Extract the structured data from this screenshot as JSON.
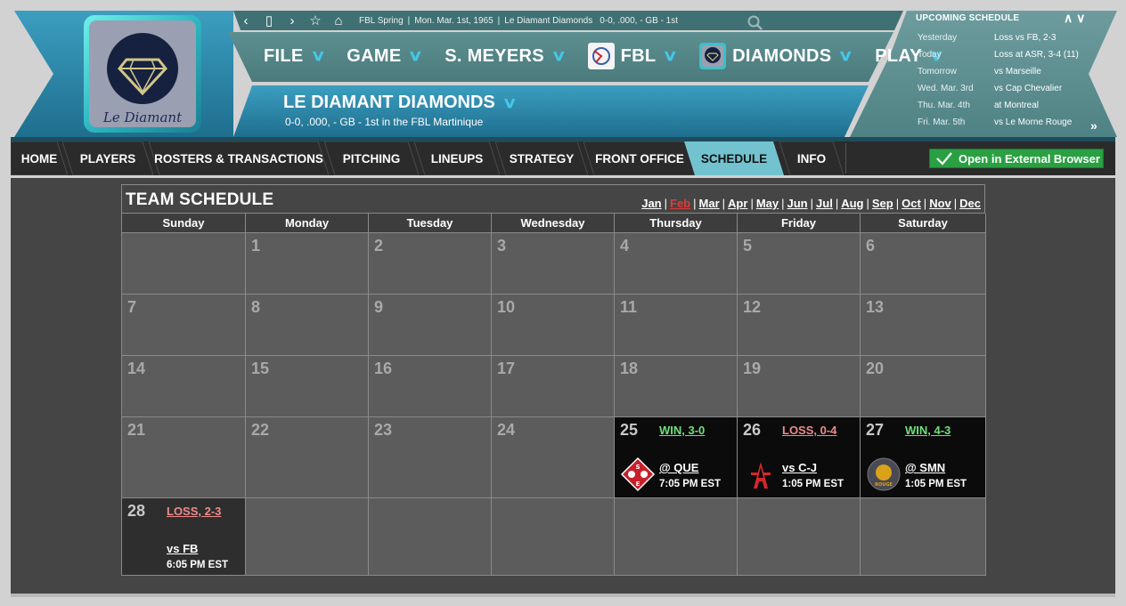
{
  "topbar": {
    "league_context": "FBL Spring",
    "date": "Mon. Mar. 1st, 1965",
    "team": "Le Diamant Diamonds",
    "record": "0-0, .000, - GB - 1st"
  },
  "logo": {
    "text": "Le Diamant"
  },
  "menu": [
    {
      "label": "FILE"
    },
    {
      "label": "GAME"
    },
    {
      "label": "S. MEYERS"
    },
    {
      "label": "FBL"
    },
    {
      "label": "DIAMONDS"
    },
    {
      "label": "PLAY"
    }
  ],
  "team_header": {
    "name": "LE DIAMANT DIAMONDS",
    "subtitle": "0-0, .000, - GB - 1st in the FBL Martinique"
  },
  "upcoming": {
    "title": "UPCOMING SCHEDULE",
    "rows": [
      {
        "day": "Yesterday",
        "result": "Loss vs FB, 2-3"
      },
      {
        "day": "Today",
        "result": "Loss at ASR, 3-4 (11)"
      },
      {
        "day": "Tomorrow",
        "result": "vs Marseille"
      },
      {
        "day": "Wed. Mar. 3rd",
        "result": "vs Cap Chevalier"
      },
      {
        "day": "Thu. Mar. 4th",
        "result": "at Montreal"
      },
      {
        "day": "Fri. Mar. 5th",
        "result": "vs Le Morne Rouge"
      }
    ]
  },
  "tabs": [
    {
      "label": "HOME"
    },
    {
      "label": "PLAYERS"
    },
    {
      "label": "ROSTERS & TRANSACTIONS"
    },
    {
      "label": "PITCHING"
    },
    {
      "label": "LINEUPS"
    },
    {
      "label": "STRATEGY"
    },
    {
      "label": "FRONT OFFICE"
    },
    {
      "label": "SCHEDULE"
    },
    {
      "label": "INFO"
    }
  ],
  "active_tab": "SCHEDULE",
  "external_button": "Open in External Browser",
  "calendar": {
    "title": "TEAM SCHEDULE",
    "months": [
      "Jan",
      "Feb",
      "Mar",
      "Apr",
      "May",
      "Jun",
      "Jul",
      "Aug",
      "Sep",
      "Oct",
      "Nov",
      "Dec"
    ],
    "current_month": "Feb",
    "weekdays": [
      "Sunday",
      "Monday",
      "Tuesday",
      "Wednesday",
      "Thursday",
      "Friday",
      "Saturday"
    ],
    "weeks": [
      [
        "",
        "1",
        "2",
        "3",
        "4",
        "5",
        "6"
      ],
      [
        "7",
        "8",
        "9",
        "10",
        "11",
        "12",
        "13"
      ],
      [
        "14",
        "15",
        "16",
        "17",
        "18",
        "19",
        "20"
      ],
      [
        "21",
        "22",
        "23",
        "24",
        "25",
        "26",
        "27"
      ],
      [
        "28",
        "",
        "",
        "",
        "",
        "",
        ""
      ]
    ],
    "games": {
      "25": {
        "result": "WIN, 3-0",
        "outcome": "win",
        "opponent": "@ QUE",
        "time": "7:05 PM EST",
        "logo": "que-logo"
      },
      "26": {
        "result": "LOSS, 0-4",
        "outcome": "loss",
        "opponent": "vs C-J",
        "time": "1:05 PM EST",
        "logo": "cj-logo"
      },
      "27": {
        "result": "WIN, 4-3",
        "outcome": "win",
        "opponent": "@ SMN",
        "time": "1:05 PM EST",
        "logo": "smn-logo"
      },
      "28": {
        "result": "LOSS, 2-3",
        "outcome": "loss",
        "opponent": "vs FB",
        "time": "6:05 PM EST",
        "logo": ""
      }
    }
  },
  "colors": {
    "header_blue": "#2a87a6",
    "header_teal": "#5a8a8c",
    "accent_cyan": "#43c7ea",
    "active_tab": "#72c3cf",
    "win": "#6ee07a",
    "loss": "#f08a8a",
    "current_month": "#e23b3b",
    "button_green": "#2aa043"
  }
}
